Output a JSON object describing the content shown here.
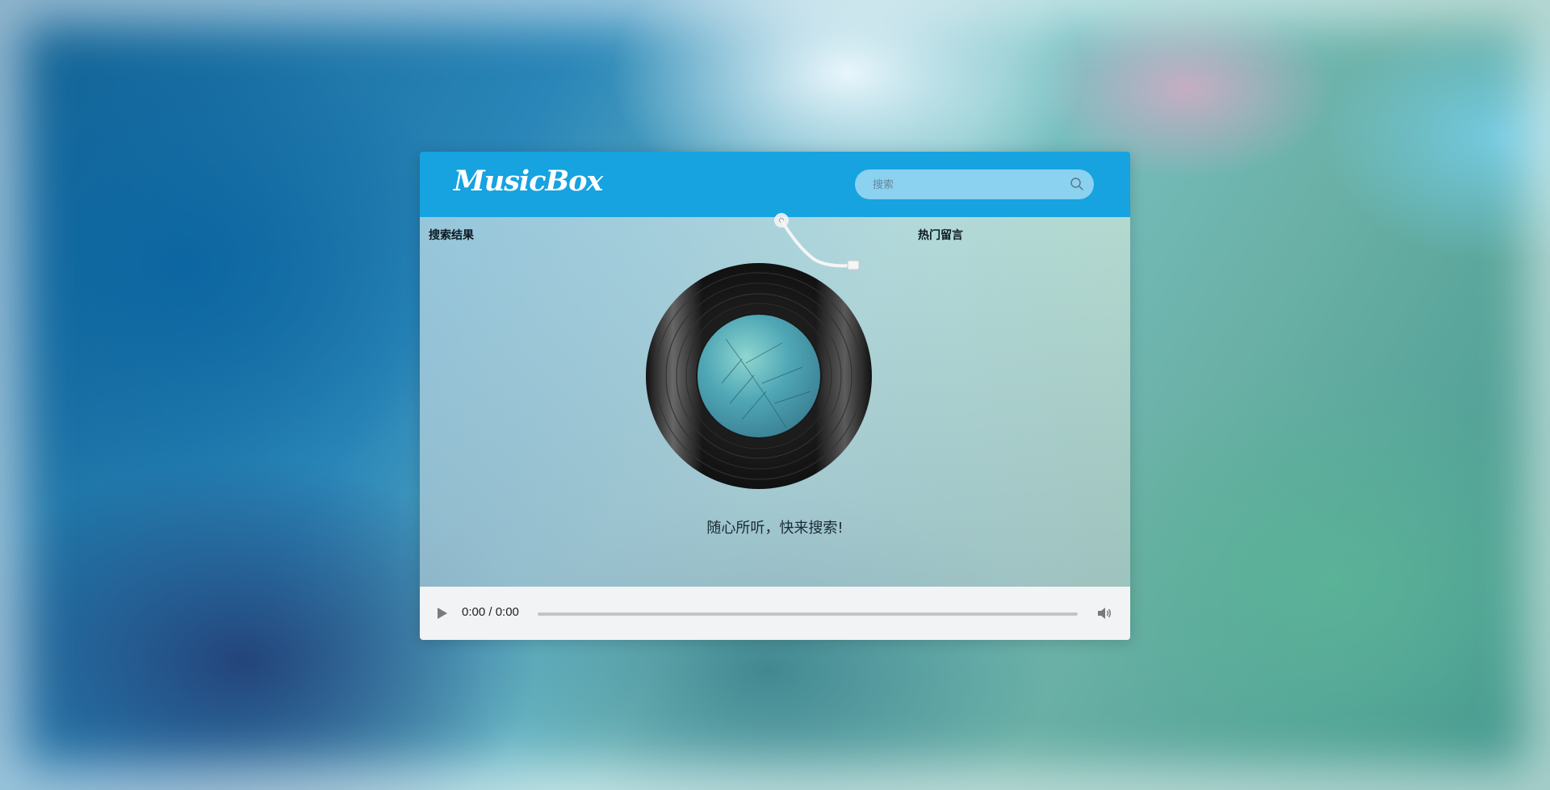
{
  "header": {
    "logo_text": "MusicBox",
    "search_placeholder": "搜索"
  },
  "main": {
    "left_panel_title": "搜索结果",
    "right_panel_title": "热门留言",
    "tagline": "随心所听，快来搜索!"
  },
  "player": {
    "current_time": "0:00",
    "duration": "0:00",
    "time_display": "0:00 / 0:00",
    "progress": 0
  },
  "colors": {
    "header": "#16a3e0",
    "player_bg": "#f1f3f4"
  },
  "icons": [
    "search-icon",
    "play-icon",
    "volume-icon",
    "tonearm-icon",
    "vinyl-record-icon"
  ]
}
